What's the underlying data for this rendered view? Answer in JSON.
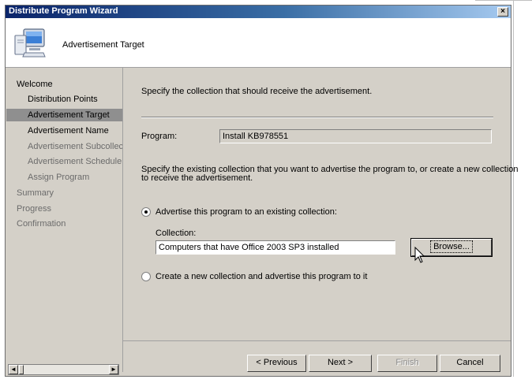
{
  "window": {
    "title": "Distribute Program Wizard",
    "close_label": "×"
  },
  "header": {
    "title": "Advertisement Target",
    "icon": "computer-monitor-icon"
  },
  "nav": {
    "items": [
      {
        "label": "Welcome",
        "level": 0,
        "state": "normal"
      },
      {
        "label": "Distribution Points",
        "level": 1,
        "state": "normal"
      },
      {
        "label": "Advertisement Target",
        "level": 1,
        "state": "selected"
      },
      {
        "label": "Advertisement Name",
        "level": 1,
        "state": "normal"
      },
      {
        "label": "Advertisement Subcollection",
        "level": 1,
        "state": "dim"
      },
      {
        "label": "Advertisement Schedule",
        "level": 1,
        "state": "dim"
      },
      {
        "label": "Assign Program",
        "level": 1,
        "state": "dim"
      },
      {
        "label": "Summary",
        "level": 0,
        "state": "dim"
      },
      {
        "label": "Progress",
        "level": 0,
        "state": "dim"
      },
      {
        "label": "Confirmation",
        "level": 0,
        "state": "dim"
      }
    ],
    "scroll_left": "◄",
    "scroll_right": "►"
  },
  "content": {
    "instruction": "Specify the collection that should receive the advertisement.",
    "program_label": "Program:",
    "program_value": "Install KB978551",
    "description_line1": "Specify the existing collection that you want to advertise the program to, or create a new collection",
    "description_line2": "to receive the advertisement.",
    "option_existing": "Advertise this program to an existing collection:",
    "collection_label": "Collection:",
    "collection_value": "Computers that have Office 2003 SP3 installed",
    "browse_label": "Browse...",
    "option_new": "Create a new collection and advertise this program to it"
  },
  "buttons": {
    "previous": "< Previous",
    "next": "Next >",
    "finish": "Finish",
    "cancel": "Cancel"
  },
  "colors": {
    "titlebar_start": "#0a246a",
    "titlebar_end": "#a6caf0",
    "dialog_face": "#d4d0c8",
    "nav_selected": "#8f8f8f"
  }
}
